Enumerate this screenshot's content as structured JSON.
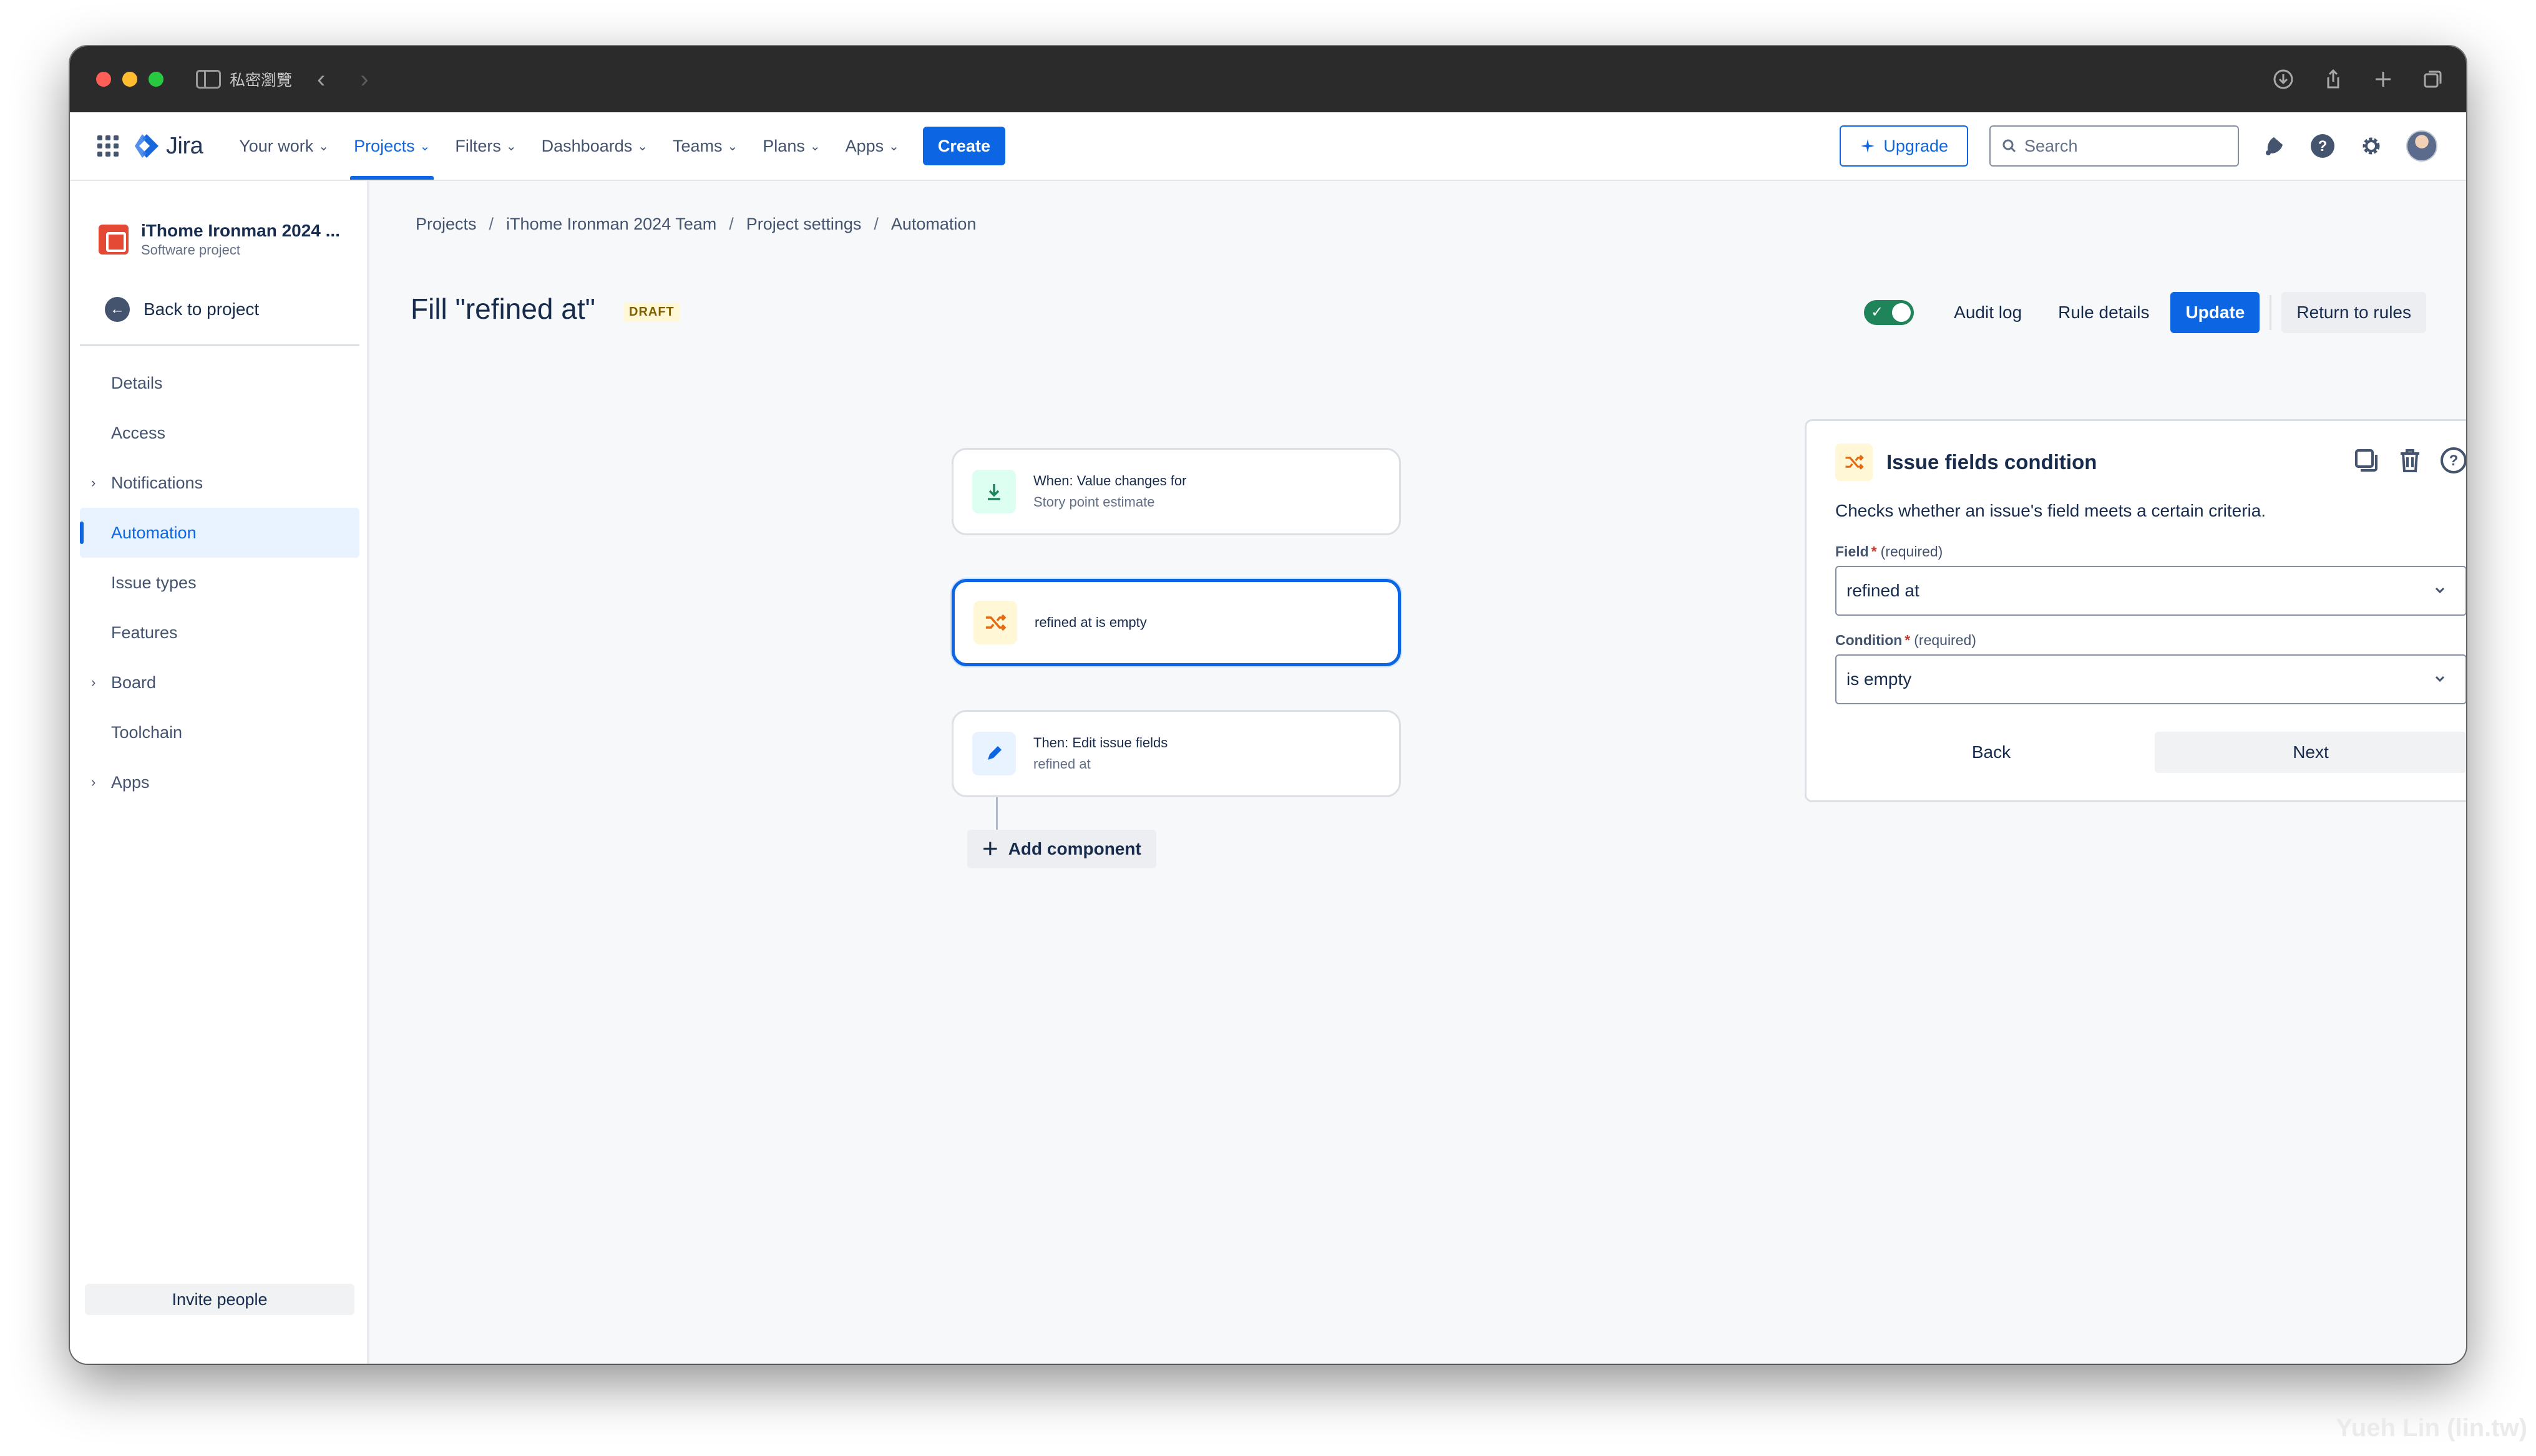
{
  "browser": {
    "private_label": "私密瀏覽",
    "back_glyph": "‹",
    "forward_glyph": "›"
  },
  "topnav": {
    "product": "Jira",
    "items": [
      {
        "label": "Your work",
        "active": false
      },
      {
        "label": "Projects",
        "active": true
      },
      {
        "label": "Filters",
        "active": false
      },
      {
        "label": "Dashboards",
        "active": false
      },
      {
        "label": "Teams",
        "active": false
      },
      {
        "label": "Plans",
        "active": false
      },
      {
        "label": "Apps",
        "active": false
      }
    ],
    "create_label": "Create",
    "upgrade_label": "Upgrade",
    "search_placeholder": "Search"
  },
  "sidebar": {
    "project_name": "iThome Ironman 2024 ...",
    "project_type": "Software project",
    "back_label": "Back to project",
    "items": [
      {
        "label": "Details",
        "expandable": false,
        "active": false
      },
      {
        "label": "Access",
        "expandable": false,
        "active": false
      },
      {
        "label": "Notifications",
        "expandable": true,
        "active": false
      },
      {
        "label": "Automation",
        "expandable": false,
        "active": true
      },
      {
        "label": "Issue types",
        "expandable": false,
        "active": false
      },
      {
        "label": "Features",
        "expandable": false,
        "active": false
      },
      {
        "label": "Board",
        "expandable": true,
        "active": false
      },
      {
        "label": "Toolchain",
        "expandable": false,
        "active": false
      },
      {
        "label": "Apps",
        "expandable": true,
        "active": false
      }
    ],
    "invite_label": "Invite people"
  },
  "breadcrumb": [
    "Projects",
    "iThome Ironman 2024 Team",
    "Project settings",
    "Automation"
  ],
  "rule": {
    "title": "Fill \"refined at\"",
    "status_badge": "DRAFT",
    "enabled": true,
    "audit_log_label": "Audit log",
    "rule_details_label": "Rule details",
    "update_label": "Update",
    "return_label": "Return to rules"
  },
  "flow": {
    "trigger": {
      "title": "When: Value changes for",
      "subtitle": "Story point estimate"
    },
    "condition": {
      "title": "refined at is empty"
    },
    "action": {
      "title": "Then: Edit issue fields",
      "subtitle": "refined at"
    },
    "add_component_label": "Add component"
  },
  "panel": {
    "title": "Issue fields condition",
    "description": "Checks whether an issue's field meets a certain criteria.",
    "field_label": "Field",
    "condition_label": "Condition",
    "required_mark": "*",
    "required_text": "(required)",
    "field_value": "refined at",
    "condition_value": "is empty",
    "back_label": "Back",
    "next_label": "Next"
  },
  "watermark": "Yueh Lin (lin.tw)",
  "colors": {
    "brand_blue": "#0c66e4",
    "toggle_green": "#1f845a",
    "draft_bg": "#fff7d6",
    "titlebar": "#2b2b2b"
  }
}
